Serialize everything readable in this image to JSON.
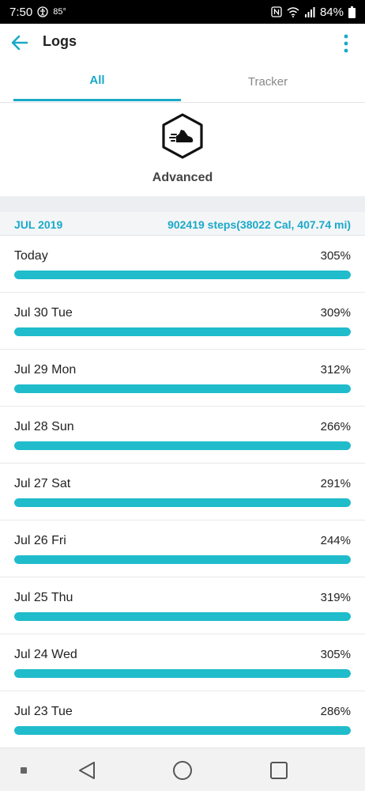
{
  "status_bar": {
    "time": "7:50",
    "temperature": "85°",
    "battery": "84%",
    "icons": [
      "accessibility-icon",
      "nfc-icon",
      "wifi-icon",
      "signal-icon",
      "battery-icon"
    ]
  },
  "app_bar": {
    "title": "Logs",
    "back_icon": "back-arrow-icon",
    "more_icon": "more-vert-icon"
  },
  "tabs": [
    {
      "label": "All",
      "active": true
    },
    {
      "label": "Tracker",
      "active": false
    }
  ],
  "hero": {
    "icon": "running-shoe-icon",
    "label": "Advanced"
  },
  "month": {
    "label": "JUL 2019",
    "summary": "902419 steps(38022 Cal, 407.74 mi)"
  },
  "logs": [
    {
      "date": "Today",
      "percent": "305%",
      "progress": 1.0
    },
    {
      "date": "Jul 30 Tue",
      "percent": "309%",
      "progress": 1.0
    },
    {
      "date": "Jul 29 Mon",
      "percent": "312%",
      "progress": 1.0
    },
    {
      "date": "Jul 28 Sun",
      "percent": "266%",
      "progress": 1.0
    },
    {
      "date": "Jul 27 Sat",
      "percent": "291%",
      "progress": 1.0
    },
    {
      "date": "Jul 26 Fri",
      "percent": "244%",
      "progress": 1.0
    },
    {
      "date": "Jul 25 Thu",
      "percent": "319%",
      "progress": 1.0
    },
    {
      "date": "Jul 24 Wed",
      "percent": "305%",
      "progress": 1.0
    },
    {
      "date": "Jul 23 Tue",
      "percent": "286%",
      "progress": 1.0
    }
  ],
  "colors": {
    "accent": "#1aa9c8",
    "bar": "#20bccb"
  },
  "nav": {
    "icons": [
      "recent-dot-icon",
      "back-triangle-icon",
      "home-circle-icon",
      "overview-square-icon"
    ]
  }
}
